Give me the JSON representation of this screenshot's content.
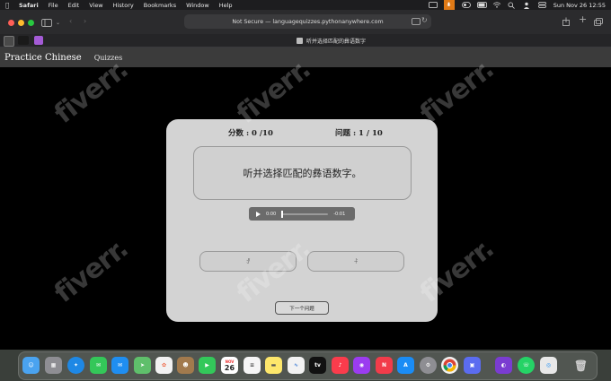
{
  "menubar": {
    "app": "Safari",
    "items": [
      "File",
      "Edit",
      "View",
      "History",
      "Bookmarks",
      "Window",
      "Help"
    ],
    "datetime": "Sun Nov 26  12:55"
  },
  "toolbar": {
    "address": "Not Secure — languagequizzes.pythonanywhere.com"
  },
  "tab": {
    "title": "听并选择匹配的彝语数字"
  },
  "site": {
    "brand": "Practice Chinese",
    "nav_quizzes": "Quizzes"
  },
  "quiz": {
    "score_label": "分数 : 0 /10",
    "question_label": "问题 : 1 / 10",
    "prompt": "听并选择匹配的彝语数字。",
    "audio_current": "0:00",
    "audio_remaining": "-0:01",
    "audio_progress": 0,
    "option_1": "ꀋ",
    "option_2": "ꊰ",
    "next_label": "下一个问题"
  },
  "watermark_text": "fiverr.",
  "colors": {
    "card_bg": "#d3d3d3",
    "page_bg": "#000000",
    "nav_bg": "#3b3b3b"
  },
  "dock": {
    "calendar_month": "NOV",
    "calendar_day": "26"
  }
}
